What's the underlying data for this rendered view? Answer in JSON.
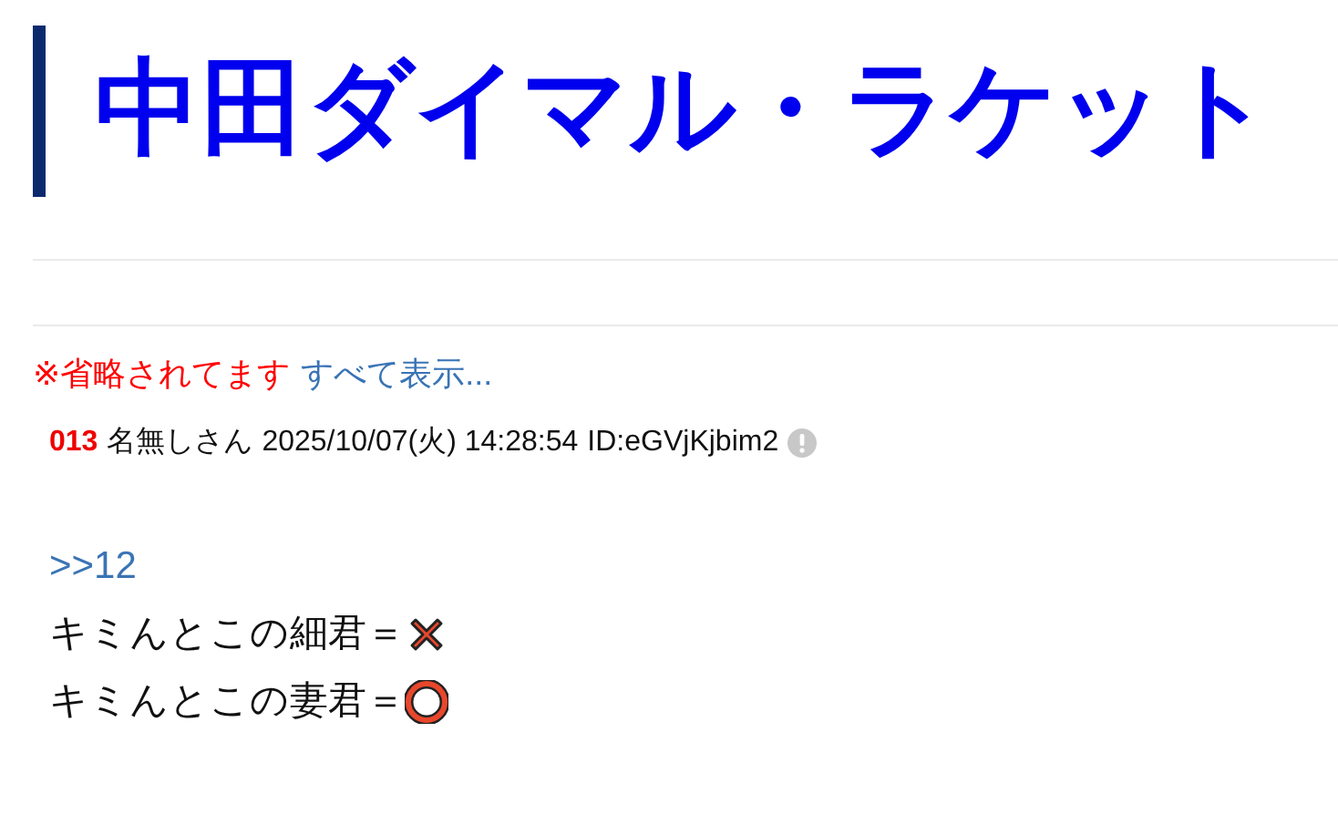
{
  "title": "中田ダイマル・ラケット",
  "notice": {
    "text": "※省略されてます",
    "link": "すべて表示..."
  },
  "post": {
    "number": "013",
    "name": "名無しさん",
    "date": "2025/10/07(火) 14:28:54",
    "id": "ID:eGVjKjbim2",
    "anchor": ">>12",
    "lines": [
      {
        "text": "キミんとこの細君＝",
        "kind": "cross"
      },
      {
        "text": "キミんとこの妻君＝",
        "kind": "circle"
      }
    ]
  }
}
